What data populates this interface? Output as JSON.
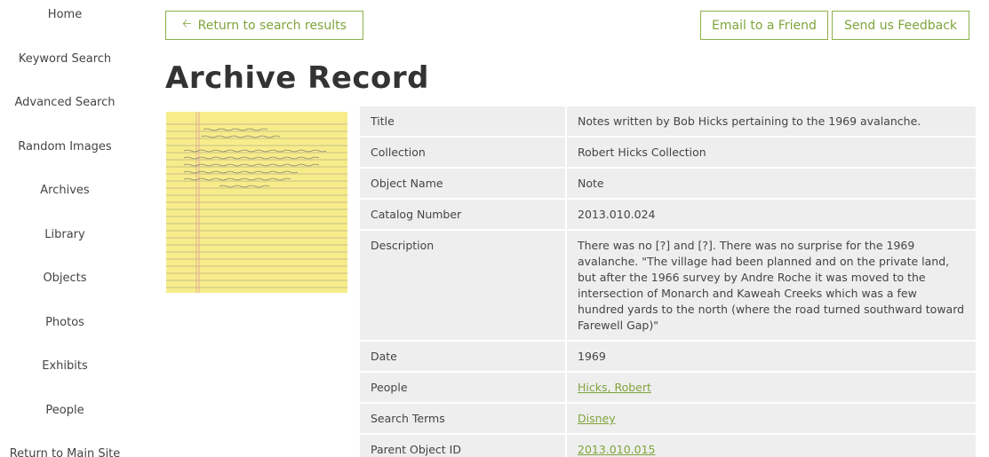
{
  "sidebar": {
    "items": [
      {
        "label": "Home"
      },
      {
        "label": "Keyword Search"
      },
      {
        "label": "Advanced Search"
      },
      {
        "label": "Random Images"
      },
      {
        "label": "Archives"
      },
      {
        "label": "Library"
      },
      {
        "label": "Objects"
      },
      {
        "label": "Photos"
      },
      {
        "label": "Exhibits"
      },
      {
        "label": "People"
      },
      {
        "label": "Return to Main Site"
      }
    ]
  },
  "toolbar": {
    "return_label": "Return to search results",
    "return_icon": "arrow-left-icon",
    "email_label": "Email to a Friend",
    "feedback_label": "Send us Feedback"
  },
  "page": {
    "title": "Archive Record"
  },
  "colors": {
    "accent": "#7fa43b",
    "row_bg": "#eeeeee",
    "paper": "#f7ec8a"
  },
  "record": {
    "rows": [
      {
        "label": "Title",
        "value": "Notes written by Bob Hicks pertaining to the 1969 avalanche."
      },
      {
        "label": "Collection",
        "value": "Robert Hicks Collection"
      },
      {
        "label": "Object Name",
        "value": "Note"
      },
      {
        "label": "Catalog Number",
        "value": "2013.010.024"
      },
      {
        "label": "Description",
        "value": "There was no [?] and [?]. There was no surprise for the 1969 avalanche. \"The village had been planned and on the private land, but after the 1966 survey by Andre Roche it was moved to the intersection of Monarch and Kaweah Creeks which was a few hundred yards to the north (where the road turned southward toward Farewell Gap)\""
      },
      {
        "label": "Date",
        "value": "1969"
      },
      {
        "label": "People",
        "value": "Hicks, Robert"
      },
      {
        "label": "Search Terms",
        "value": "Disney"
      },
      {
        "label": "Parent Object ID",
        "value": "2013.010.015"
      }
    ]
  }
}
